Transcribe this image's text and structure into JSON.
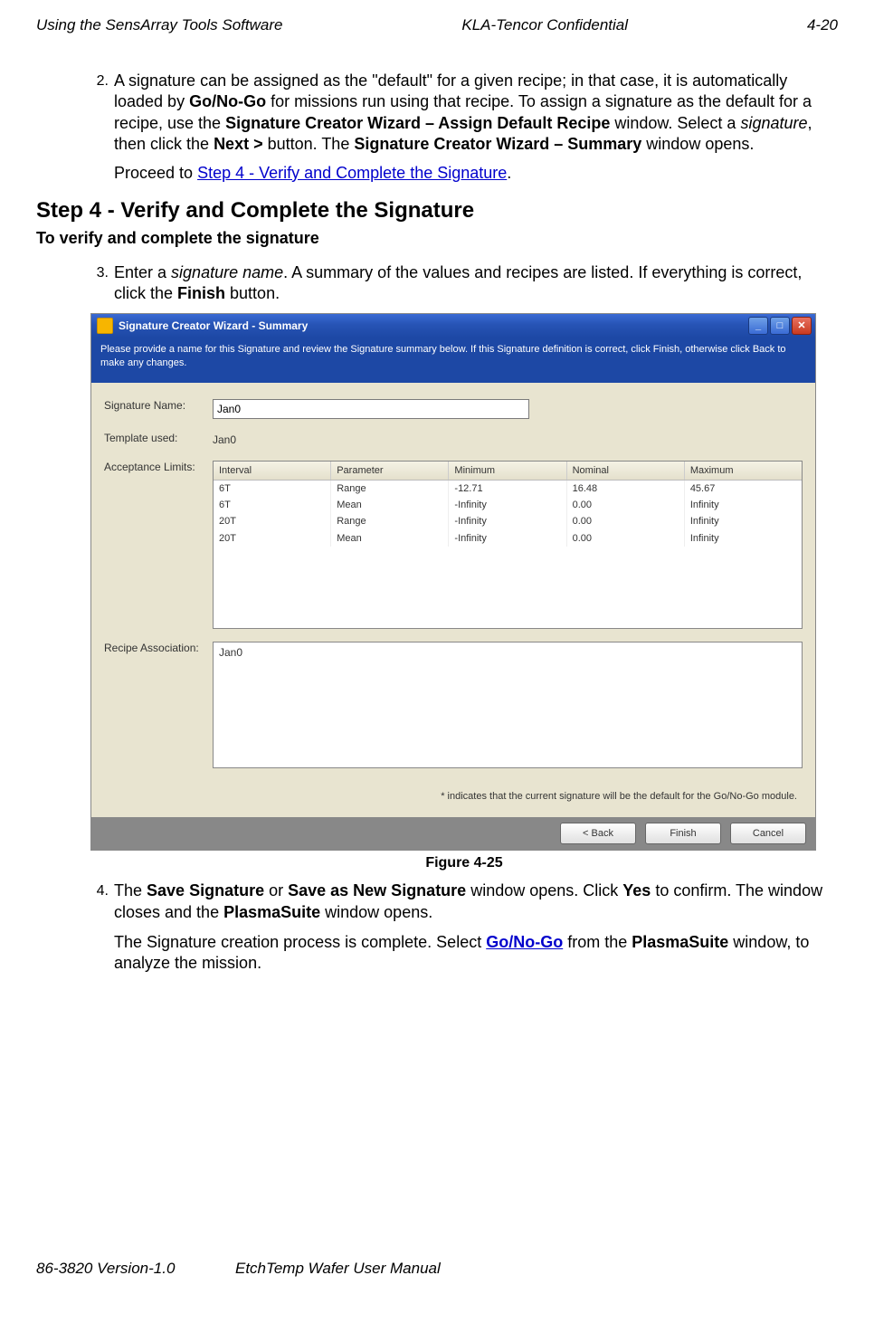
{
  "header": {
    "left": "Using the SensArray Tools Software",
    "center": "KLA-Tencor Confidential",
    "right": "4-20"
  },
  "footer": {
    "left": "86-3820 Version-1.0",
    "center": "EtchTemp Wafer User Manual"
  },
  "step2": {
    "num": "2.",
    "text_plain_1": "A signature can be assigned as the \"default\" for a given recipe; in that case, it is automatically loaded by ",
    "b1": "Go/No-Go",
    "text_plain_2": " for missions run using that recipe. To assign a signature as the default for a recipe, use the ",
    "b2": "Signature Creator Wizard – Assign Default Recipe",
    "text_plain_3": " window. Select a ",
    "i1": "signature",
    "text_plain_4": ", then click the ",
    "b3": "Next >",
    "text_plain_5": " button. The ",
    "b4": "Signature Creator Wizard – Summary",
    "text_plain_6": " window opens.",
    "proceed_prefix": "Proceed to ",
    "proceed_link": "Step 4 - Verify and Complete the Signature",
    "proceed_suffix": "."
  },
  "heading": "Step 4 - Verify and Complete the Signature",
  "subheading": "To verify and complete the signature",
  "step3": {
    "num": "3.",
    "t1": "Enter a ",
    "i1": "signature name",
    "t2": ". A summary of the values and recipes are listed. If everything is correct, click the ",
    "b1": "Finish",
    "t3": " button."
  },
  "figure_caption": "Figure 4-25",
  "step4": {
    "num": "4.",
    "t1": "The ",
    "b1": "Save Signature",
    "t2": " or ",
    "b2": "Save as New Signature",
    "t3": " window opens. Click ",
    "b3": "Yes",
    "t4": " to confirm. The window closes and the ",
    "b4": "PlasmaSuite",
    "t5": " window opens.",
    "p2_t1": "The Signature creation process is complete. Select ",
    "p2_link": "Go/No-Go",
    "p2_t2": " from the ",
    "p2_b1": "PlasmaSuite",
    "p2_t3": " window, to analyze the mission."
  },
  "window": {
    "title": "Signature Creator Wizard - Summary",
    "instructions": "Please provide a name for this Signature and review the Signature summary below. If this Signature definition is correct, click Finish, otherwise click Back to make any changes.",
    "labels": {
      "sig_name": "Signature Name:",
      "template": "Template used:",
      "accept": "Acceptance Limits:",
      "recipe": "Recipe Association:"
    },
    "sig_name_value": "Jan0",
    "template_value": "Jan0",
    "grid": {
      "headers": [
        "Interval",
        "Parameter",
        "Minimum",
        "Nominal",
        "Maximum"
      ],
      "rows": [
        [
          "6T",
          "Range",
          "-12.71",
          "16.48",
          "45.67"
        ],
        [
          "6T",
          "Mean",
          "-Infinity",
          "0.00",
          "Infinity"
        ],
        [
          "20T",
          "Range",
          "-Infinity",
          "0.00",
          "Infinity"
        ],
        [
          "20T",
          "Mean",
          "-Infinity",
          "0.00",
          "Infinity"
        ]
      ]
    },
    "recipe_value": "Jan0",
    "hint": "* indicates that the current signature will be the  default for the Go/No-Go module.",
    "buttons": {
      "back": "< Back",
      "finish": "Finish",
      "cancel": "Cancel"
    }
  }
}
